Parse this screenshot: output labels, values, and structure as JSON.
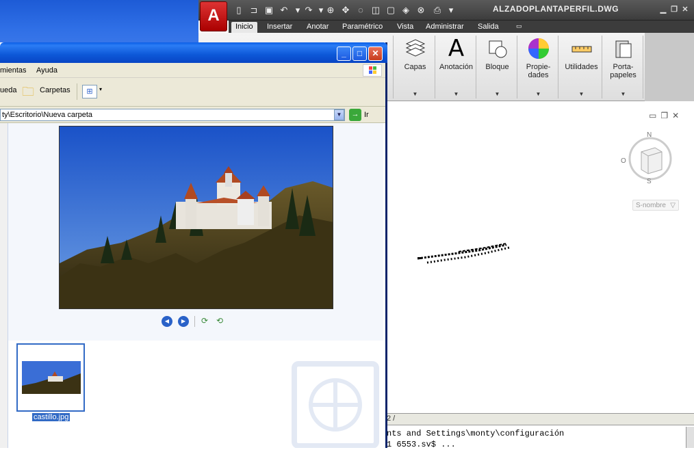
{
  "autocad": {
    "title": "ALZADOPLANTAPERFIL.DWG",
    "logo": "A",
    "tabs": [
      "Inicio",
      "Insertar",
      "Anotar",
      "Paramétrico",
      "Vista",
      "Administrar",
      "Salida"
    ],
    "panels": [
      {
        "label": "Capas",
        "icon": "layers-icon"
      },
      {
        "label": "Anotación",
        "icon": "annotation-icon"
      },
      {
        "label": "Bloque",
        "icon": "block-icon"
      },
      {
        "label": "Propie-\ndades",
        "icon": "properties-icon"
      },
      {
        "label": "Utilidades",
        "icon": "utilities-icon"
      },
      {
        "label": "Porta-\npapeles",
        "icon": "clipboard-icon"
      }
    ],
    "viewcube": {
      "n": "N",
      "o": "O",
      "s": "S"
    },
    "ucs_dropdown": "S-nombre",
    "layout_tab": "2",
    "command_lines": [
      "nts and Settings\\monty\\configuración",
      "1 6553.sv$ ..."
    ]
  },
  "explorer": {
    "menu": [
      "mientas",
      "Ayuda"
    ],
    "toolbar": {
      "search": "ueda",
      "folders": "Carpetas"
    },
    "address": "ty\\Escritorio\\Nueva carpeta",
    "go_label": "Ir",
    "thumbnail_label": "castillo.jpg"
  },
  "colors": {
    "xp_blue": "#0a5fe6",
    "acad_dark": "#3c3c3c",
    "selection": "#316ac5"
  }
}
